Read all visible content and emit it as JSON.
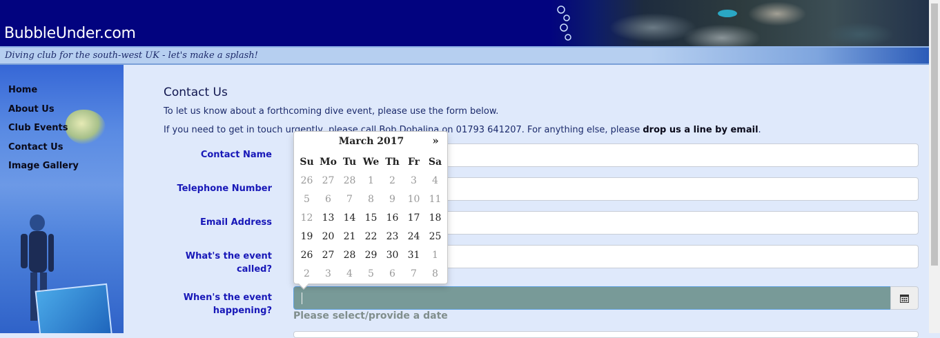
{
  "header": {
    "site_name": "BubbleUnder.com",
    "tagline": "Diving club for the south-west UK - let's make a splash!"
  },
  "nav": {
    "items": [
      {
        "label": "Home"
      },
      {
        "label": "About Us"
      },
      {
        "label": "Club Events"
      },
      {
        "label": "Contact Us"
      },
      {
        "label": "Image Gallery"
      }
    ]
  },
  "content": {
    "heading": "Contact Us",
    "para1": "To let us know about a forthcoming dive event, please use the form below.",
    "para2_start": "If you need to get in touch urgently, please call Bob Dobalina on 01793 641207. For anything else, please ",
    "para2_link": "drop us a line by email",
    "para2_end": "."
  },
  "form": {
    "fields": [
      {
        "label": "Contact Name",
        "value": ""
      },
      {
        "label": "Telephone Number",
        "value": ""
      },
      {
        "label": "Email Address",
        "value": ""
      },
      {
        "label_line1": "What's the event",
        "label_line2": "called?",
        "value": ""
      },
      {
        "label_line1": "When's the event",
        "label_line2": "happening?",
        "value": ""
      }
    ],
    "date_hint": "Please select/provide a date"
  },
  "datepicker": {
    "title": "March 2017",
    "next": "»",
    "weekdays": [
      "Su",
      "Mo",
      "Tu",
      "We",
      "Th",
      "Fr",
      "Sa"
    ],
    "weeks": [
      [
        "26",
        "27",
        "28",
        "1",
        "2",
        "3",
        "4"
      ],
      [
        "5",
        "6",
        "7",
        "8",
        "9",
        "10",
        "11"
      ],
      [
        "12",
        "13",
        "14",
        "15",
        "16",
        "17",
        "18"
      ],
      [
        "19",
        "20",
        "21",
        "22",
        "23",
        "24",
        "25"
      ],
      [
        "26",
        "27",
        "28",
        "29",
        "30",
        "31",
        "1"
      ],
      [
        "2",
        "3",
        "4",
        "5",
        "6",
        "7",
        "8"
      ]
    ],
    "disabled_until_week": 2,
    "disabled_until_day": 0,
    "trailing_from_week": 4,
    "trailing_from_day": 6
  },
  "icons": {
    "calendar": "calendar-icon"
  }
}
